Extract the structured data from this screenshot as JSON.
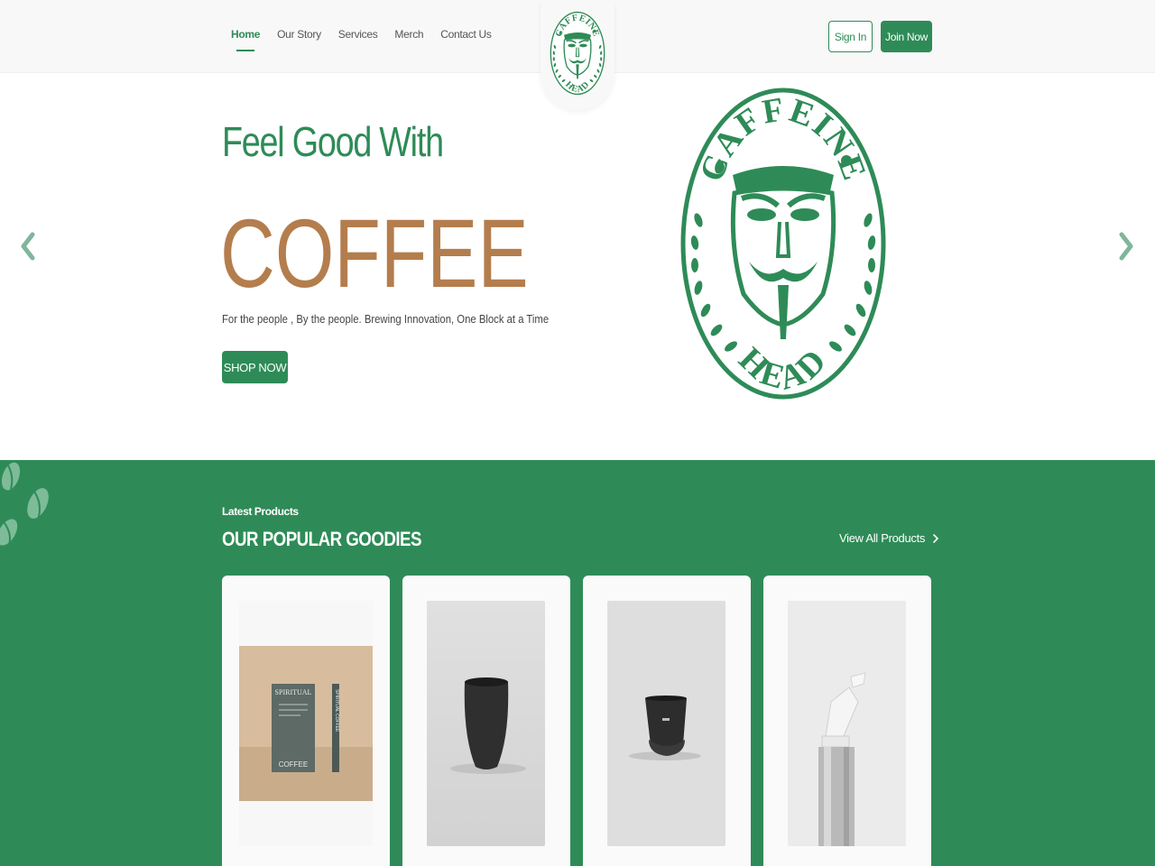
{
  "nav": {
    "links": [
      "Home",
      "Our Story",
      "Services",
      "Merch",
      "Contact Us"
    ],
    "active": "Home",
    "sign_in": "Sign In",
    "join_now": "Join Now"
  },
  "logo": {
    "text_top": "CAFFEINE",
    "text_bottom": "HEAD"
  },
  "hero": {
    "pretitle": "Feel Good With",
    "title": "COFFEE",
    "tagline": "For the people , By the people. Brewing Innovation, One Block at a Time",
    "cta": "SHOP NOW"
  },
  "products": {
    "eyebrow": "Latest Products",
    "title": "OUR POPULAR GOODIES",
    "view_all": "View All Products",
    "items": [
      {
        "name": "coffee-box",
        "box_brand": "SPIRITUAL",
        "box_label": "COFFEE",
        "box_spine": "SPIRITUAL COFFEE"
      },
      {
        "name": "black-tumbler"
      },
      {
        "name": "black-cup-with-lid"
      },
      {
        "name": "aluminum-spray-bottle"
      }
    ]
  },
  "colors": {
    "brand_green": "#2e8b57",
    "coffee_brown": "#b47d4d",
    "nav_bg": "#f8f8f8"
  },
  "icons": {
    "prev": "chevron-left-icon",
    "next": "chevron-right-icon",
    "view_all": "chevron-right-icon",
    "decor": "coffee-bean-icon"
  }
}
